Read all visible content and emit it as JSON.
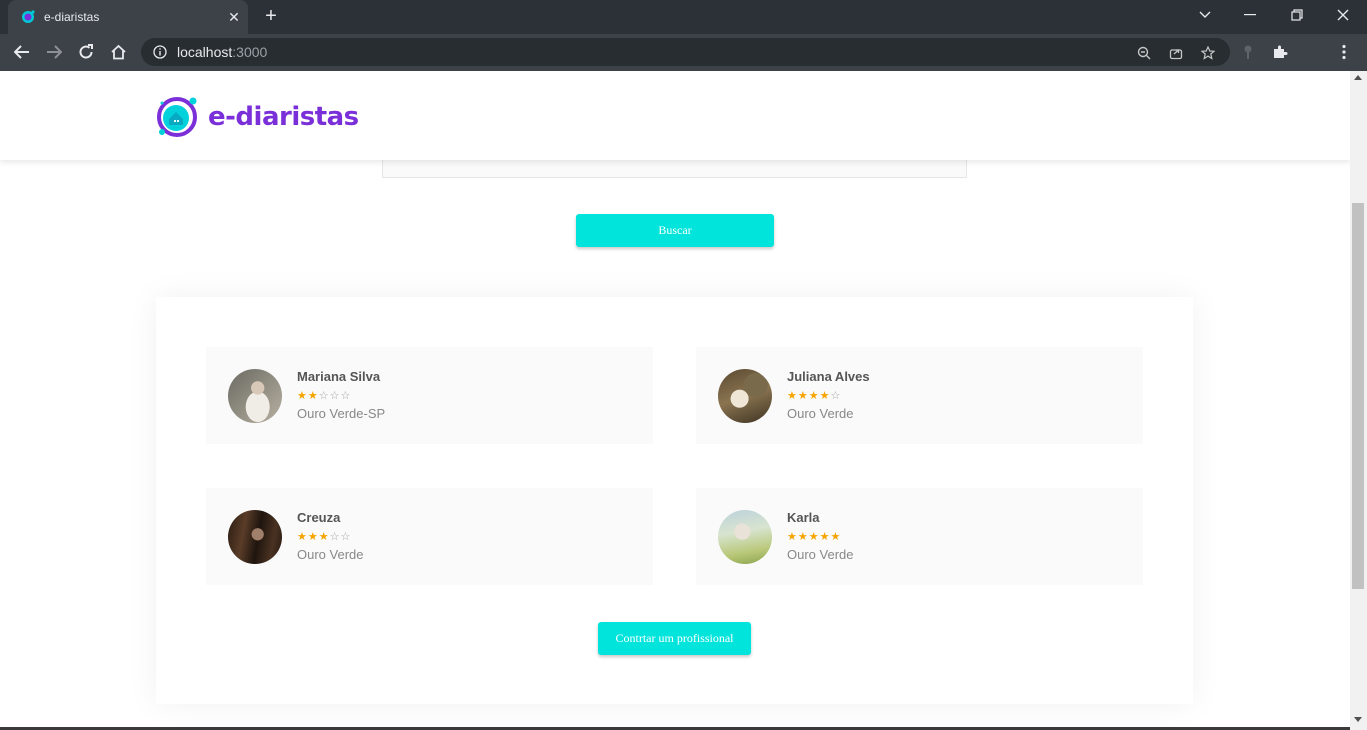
{
  "browser": {
    "tab_title": "e-diaristas",
    "new_tab_icon": "plus-icon",
    "url_host": "localhost",
    "url_port": ":3000",
    "colors": {
      "frame": "#2b3136",
      "toolbar": "#3c4248",
      "omnibox": "#282d31"
    }
  },
  "app": {
    "logo_text": "e-diaristas",
    "brand_color": "#7a2fd8",
    "accent_color": "#00e4dc"
  },
  "search": {
    "button_label": "Buscar"
  },
  "professionals": [
    {
      "name": "Mariana Silva",
      "rating": 2,
      "max_rating": 5,
      "city": "Ouro Verde-SP"
    },
    {
      "name": "Juliana Alves",
      "rating": 4,
      "max_rating": 5,
      "city": "Ouro Verde"
    },
    {
      "name": "Creuza",
      "rating": 3,
      "max_rating": 5,
      "city": "Ouro Verde"
    },
    {
      "name": "Karla",
      "rating": 5,
      "max_rating": 5,
      "city": "Ouro Verde"
    }
  ],
  "cta": {
    "label": "Contrtar um profissional"
  }
}
